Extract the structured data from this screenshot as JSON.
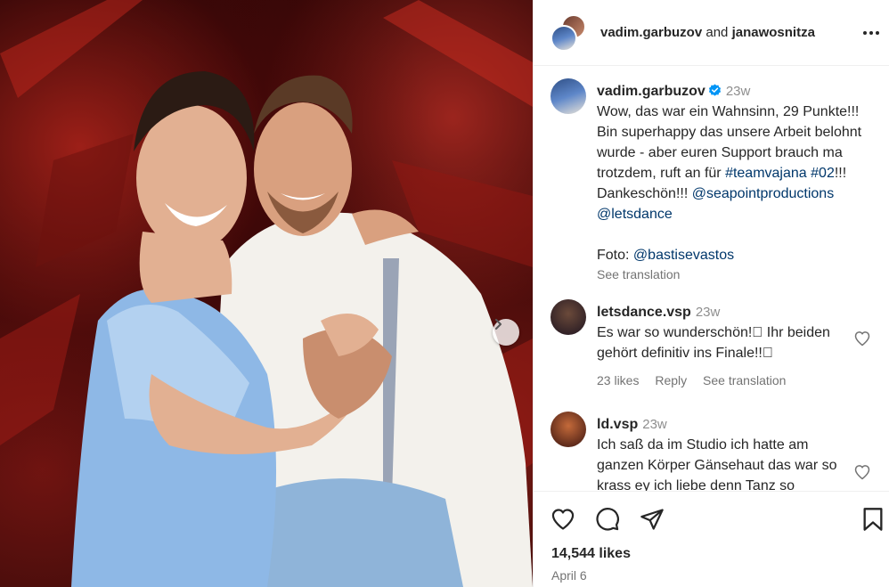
{
  "post": {
    "carousel_next_icon": "chevron-right-icon",
    "header": {
      "user1": "vadim.garbuzov",
      "and_text": "and",
      "user2": "janawosnitza",
      "more_icon": "more-horizontal-icon"
    },
    "caption": {
      "username": "vadim.garbuzov",
      "verified_icon": "verified-badge-icon",
      "time": "23w",
      "text_plain": "Wow, das war ein Wahnsinn, 29 Punkte!!! Bin superhappy das unsere Arbeit belohnt wurde - aber euren Support brauch ma trotzdem, ruft an für",
      "hashtag": "#teamvajana",
      "hashtag2": "#02",
      "tail": "!!! Dankeschön!!!",
      "mention1": "@seapointproductions",
      "mention2": "@letsdance",
      "photo_credit_label": "Foto:",
      "photo_credit_mention": "@bastisevastos",
      "see_translation": "See translation"
    },
    "comments": [
      {
        "username": "letsdance.vsp",
        "time": "23w",
        "text": "Es war so wunderschön!\u0000 Ihr beiden gehört definitiv ins Finale!!\u0000",
        "likes": "23 likes",
        "reply": "Reply",
        "see_translation": "See translation",
        "heart_icon": "heart-outline-icon"
      },
      {
        "username": "ld.vsp",
        "time": "23w",
        "text": "Ich saß da im Studio ich hatte am ganzen Körper Gänsehaut das war so krass ey ich liebe denn Tanz so",
        "heart_icon": "heart-outline-icon"
      }
    ],
    "actions": {
      "like_icon": "heart-outline-icon",
      "comment_icon": "comment-icon",
      "share_icon": "share-icon",
      "save_icon": "bookmark-icon"
    },
    "likes_count": "14,544 likes",
    "date": "April 6"
  },
  "colors": {
    "link": "#00376b",
    "verified": "#0095f6",
    "muted": "#737373",
    "text": "#262626"
  }
}
